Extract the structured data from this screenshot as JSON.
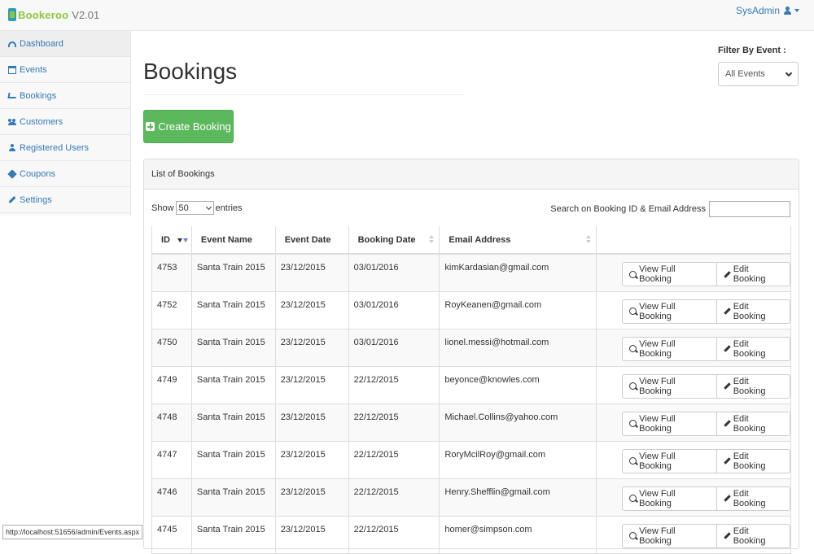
{
  "brand": {
    "name": "Bookeroo",
    "version": "V2.01"
  },
  "user": {
    "name": "SysAdmin"
  },
  "sidebar": {
    "items": [
      {
        "label": "Dashboard",
        "icon": "dashboard-icon"
      },
      {
        "label": "Events",
        "icon": "calendar-icon"
      },
      {
        "label": "Bookings",
        "icon": "cart-icon"
      },
      {
        "label": "Customers",
        "icon": "users-icon"
      },
      {
        "label": "Registered Users",
        "icon": "user-icon"
      },
      {
        "label": "Coupons",
        "icon": "tag-icon"
      },
      {
        "label": "Settings",
        "icon": "wrench-icon"
      }
    ]
  },
  "page": {
    "title": "Bookings",
    "filter_label": "Filter By Event :",
    "filter_value": "All Events",
    "create_button": "Create Booking"
  },
  "panel": {
    "heading": "List of Bookings",
    "show_label": "Show",
    "entries_value": "50",
    "entries_label": "entries",
    "search_label": "Search on Booking ID & Email Address"
  },
  "table": {
    "columns": [
      "ID",
      "Event Name",
      "Event Date",
      "Booking Date",
      "Email Address"
    ],
    "view_label": "View Full Booking",
    "edit_label": "Edit Booking",
    "rows": [
      {
        "id": "4753",
        "event": "Santa Train 2015",
        "event_date": "23/12/2015",
        "booking_date": "03/01/2016",
        "email": "kimKardasian@gmail.com"
      },
      {
        "id": "4752",
        "event": "Santa Train 2015",
        "event_date": "23/12/2015",
        "booking_date": "03/01/2016",
        "email": "RoyKeanen@gmail.com"
      },
      {
        "id": "4750",
        "event": "Santa Train 2015",
        "event_date": "23/12/2015",
        "booking_date": "03/01/2016",
        "email": "lionel.messi@hotmail.com"
      },
      {
        "id": "4749",
        "event": "Santa Train 2015",
        "event_date": "23/12/2015",
        "booking_date": "22/12/2015",
        "email": "beyonce@knowles.com"
      },
      {
        "id": "4748",
        "event": "Santa Train 2015",
        "event_date": "23/12/2015",
        "booking_date": "22/12/2015",
        "email": "Michael.Collins@yahoo.com"
      },
      {
        "id": "4747",
        "event": "Santa Train 2015",
        "event_date": "23/12/2015",
        "booking_date": "22/12/2015",
        "email": "RoryMcilRoy@gmail.com"
      },
      {
        "id": "4746",
        "event": "Santa Train 2015",
        "event_date": "23/12/2015",
        "booking_date": "22/12/2015",
        "email": "Henry.Shefflin@gmail.com"
      },
      {
        "id": "4745",
        "event": "Santa Train 2015",
        "event_date": "23/12/2015",
        "booking_date": "22/12/2015",
        "email": "homer@simpson.com"
      }
    ]
  },
  "status_bar": {
    "url": "http://localhost:51656/admin/Events.aspx"
  },
  "colors": {
    "brand_green": "#8cc63f",
    "brand_teal": "#2e9fb0",
    "link_blue": "#337ab7",
    "success_green": "#5cb85c"
  }
}
